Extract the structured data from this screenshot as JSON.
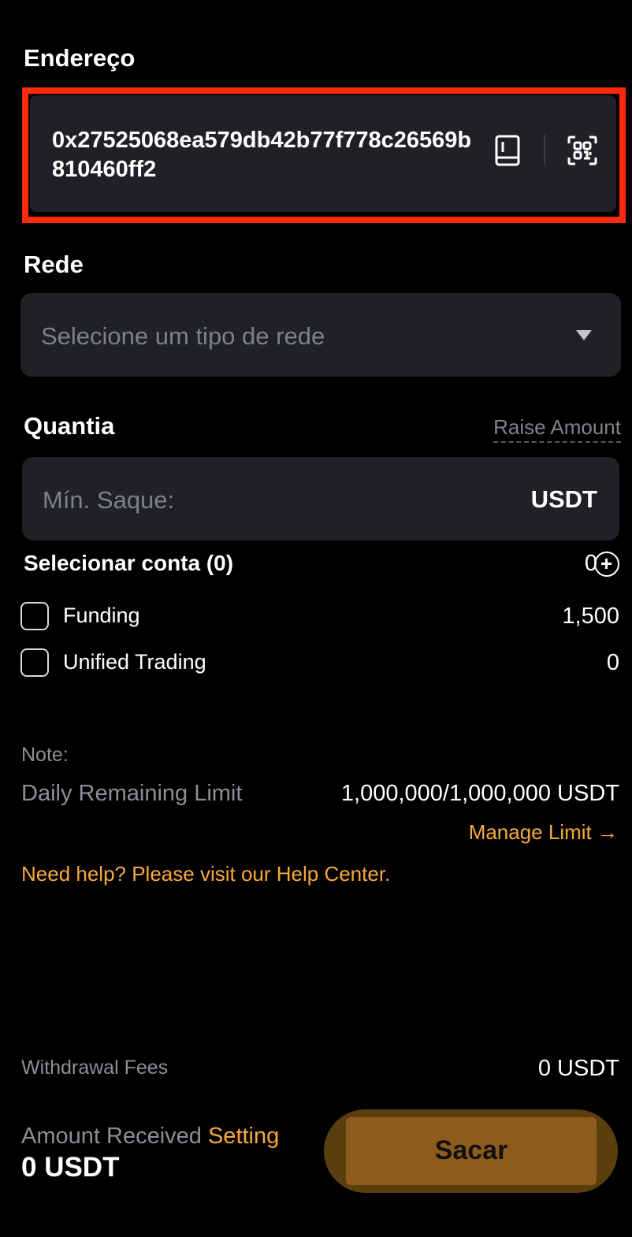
{
  "address": {
    "label": "Endereço",
    "value": "0x27525068ea579db42b77f778c26569b810460ff2"
  },
  "network": {
    "label": "Rede",
    "placeholder": "Selecione um tipo de rede"
  },
  "amount": {
    "label": "Quantia",
    "raise_link": "Raise Amount",
    "placeholder": "Mín. Saque:",
    "unit": "USDT"
  },
  "accounts": {
    "title": "Selecionar conta (0)",
    "selected_total": "0",
    "items": [
      {
        "label": "Funding",
        "value": "1,500"
      },
      {
        "label": "Unified Trading",
        "value": "0"
      }
    ]
  },
  "note": {
    "label": "Note:",
    "limit_label": "Daily Remaining Limit",
    "limit_value": "1,000,000/1,000,000 USDT",
    "manage_link": "Manage Limit →",
    "help_text": "Need help? Please visit our Help Center."
  },
  "footer": {
    "fees_label": "Withdrawal Fees",
    "fees_value": "0 USDT",
    "received_label": "Amount Received",
    "received_setting": "Setting",
    "received_value": "0 USDT",
    "submit_label": "Sacar"
  },
  "colors": {
    "accent": "#f7a93c",
    "highlight_border": "#ff2a0b",
    "field_bg": "#1f2126",
    "button": "#8d5c1d"
  }
}
